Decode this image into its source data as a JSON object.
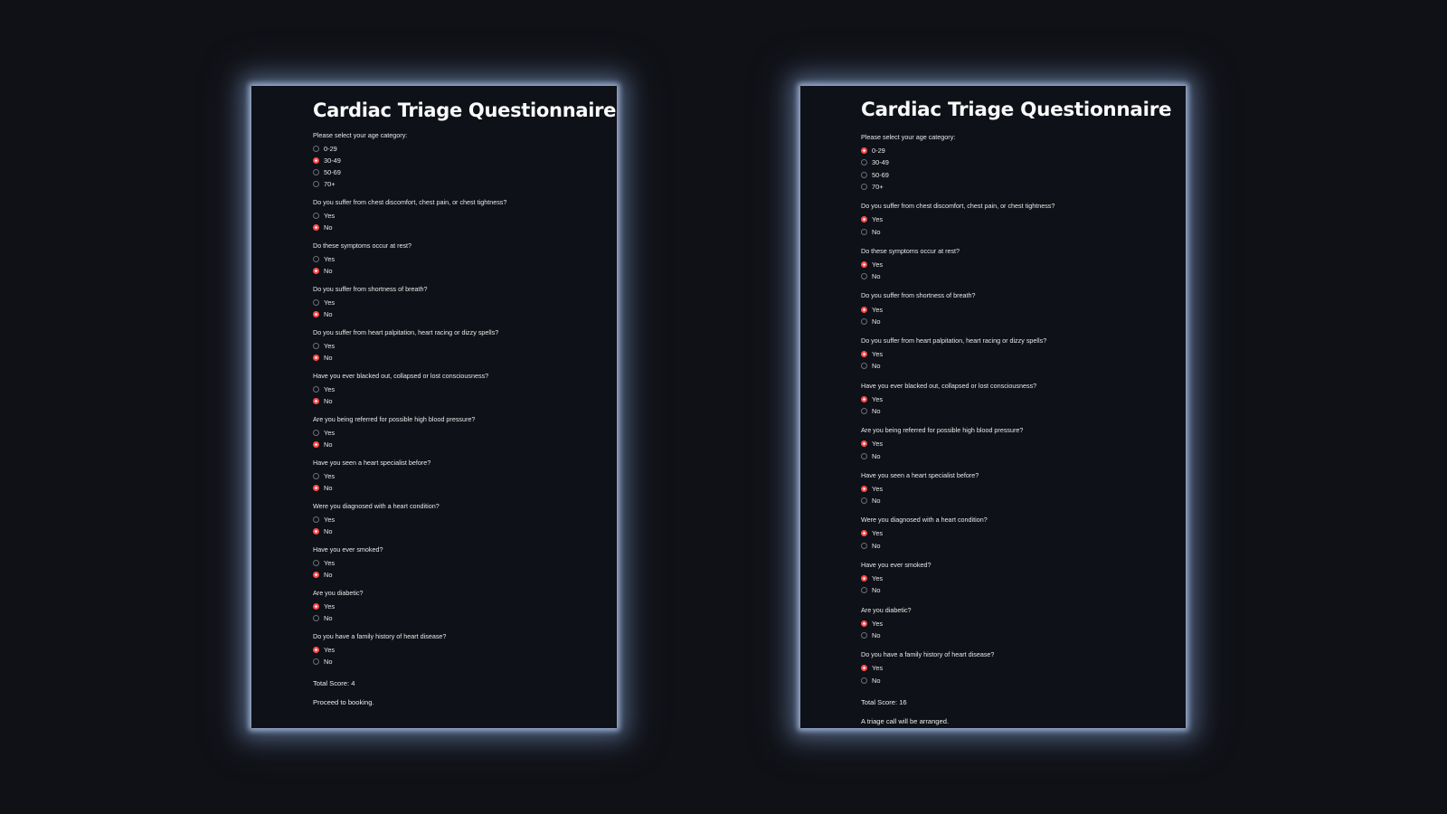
{
  "left": {
    "title": "Cardiac Triage Questionnaire",
    "questions": [
      {
        "label": "Please select your age category:",
        "options": [
          "0-29",
          "30-49",
          "50-69",
          "70+"
        ],
        "selected": 1
      },
      {
        "label": "Do you suffer from chest discomfort, chest pain, or chest tightness?",
        "options": [
          "Yes",
          "No"
        ],
        "selected": 1
      },
      {
        "label": "Do these symptoms occur at rest?",
        "options": [
          "Yes",
          "No"
        ],
        "selected": 1
      },
      {
        "label": "Do you suffer from shortness of breath?",
        "options": [
          "Yes",
          "No"
        ],
        "selected": 1
      },
      {
        "label": "Do you suffer from heart palpitation, heart racing or dizzy spells?",
        "options": [
          "Yes",
          "No"
        ],
        "selected": 1
      },
      {
        "label": "Have you ever blacked out, collapsed or lost consciousness?",
        "options": [
          "Yes",
          "No"
        ],
        "selected": 1
      },
      {
        "label": "Are you being referred for possible high blood pressure?",
        "options": [
          "Yes",
          "No"
        ],
        "selected": 1
      },
      {
        "label": "Have you seen a heart specialist before?",
        "options": [
          "Yes",
          "No"
        ],
        "selected": 1
      },
      {
        "label": "Were you diagnosed with a heart condition?",
        "options": [
          "Yes",
          "No"
        ],
        "selected": 1
      },
      {
        "label": "Have you ever smoked?",
        "options": [
          "Yes",
          "No"
        ],
        "selected": 1
      },
      {
        "label": "Are you diabetic?",
        "options": [
          "Yes",
          "No"
        ],
        "selected": 0
      },
      {
        "label": "Do you have a family history of heart disease?",
        "options": [
          "Yes",
          "No"
        ],
        "selected": 0
      }
    ],
    "score_text": "Total Score: 4",
    "message": "Proceed to booking."
  },
  "right": {
    "title": "Cardiac Triage Questionnaire",
    "questions": [
      {
        "label": "Please select your age category:",
        "options": [
          "0-29",
          "30-49",
          "50-69",
          "70+"
        ],
        "selected": 0
      },
      {
        "label": "Do you suffer from chest discomfort, chest pain, or chest tightness?",
        "options": [
          "Yes",
          "No"
        ],
        "selected": 0
      },
      {
        "label": "Do these symptoms occur at rest?",
        "options": [
          "Yes",
          "No"
        ],
        "selected": 0
      },
      {
        "label": "Do you suffer from shortness of breath?",
        "options": [
          "Yes",
          "No"
        ],
        "selected": 0
      },
      {
        "label": "Do you suffer from heart palpitation, heart racing or dizzy spells?",
        "options": [
          "Yes",
          "No"
        ],
        "selected": 0
      },
      {
        "label": "Have you ever blacked out, collapsed or lost consciousness?",
        "options": [
          "Yes",
          "No"
        ],
        "selected": 0
      },
      {
        "label": "Are you being referred for possible high blood pressure?",
        "options": [
          "Yes",
          "No"
        ],
        "selected": 0
      },
      {
        "label": "Have you seen a heart specialist before?",
        "options": [
          "Yes",
          "No"
        ],
        "selected": 0
      },
      {
        "label": "Were you diagnosed with a heart condition?",
        "options": [
          "Yes",
          "No"
        ],
        "selected": 0
      },
      {
        "label": "Have you ever smoked?",
        "options": [
          "Yes",
          "No"
        ],
        "selected": 0
      },
      {
        "label": "Are you diabetic?",
        "options": [
          "Yes",
          "No"
        ],
        "selected": 0
      },
      {
        "label": "Do you have a family history of heart disease?",
        "options": [
          "Yes",
          "No"
        ],
        "selected": 0
      }
    ],
    "score_text": "Total Score: 16",
    "message": "A triage call will be arranged."
  },
  "colors": {
    "background": "#101116",
    "panel": "#0e1117",
    "radio_selected": "#ff4b4b",
    "radio_unselected": "#6b6e78",
    "glow": "#aabee1"
  }
}
